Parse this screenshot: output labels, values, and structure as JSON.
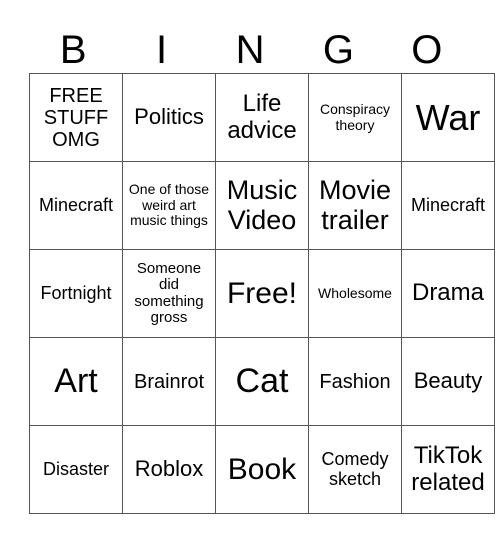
{
  "header": {
    "letters": [
      "B",
      "I",
      "N",
      "G",
      "O"
    ]
  },
  "cells": [
    [
      "FREE STUFF OMG",
      "Politics",
      "Life advice",
      "Conspiracy theory",
      "War"
    ],
    [
      "Minecraft",
      "One of those weird art music things",
      "Music Video",
      "Movie trailer",
      "Minecraft"
    ],
    [
      "Fortnight",
      "Someone did something gross",
      "Free!",
      "Wholesome",
      "Drama"
    ],
    [
      "Art",
      "Brainrot",
      "Cat",
      "Fashion",
      "Beauty"
    ],
    [
      "Disaster",
      "Roblox",
      "Book",
      "Comedy sketch",
      "TikTok related"
    ]
  ]
}
